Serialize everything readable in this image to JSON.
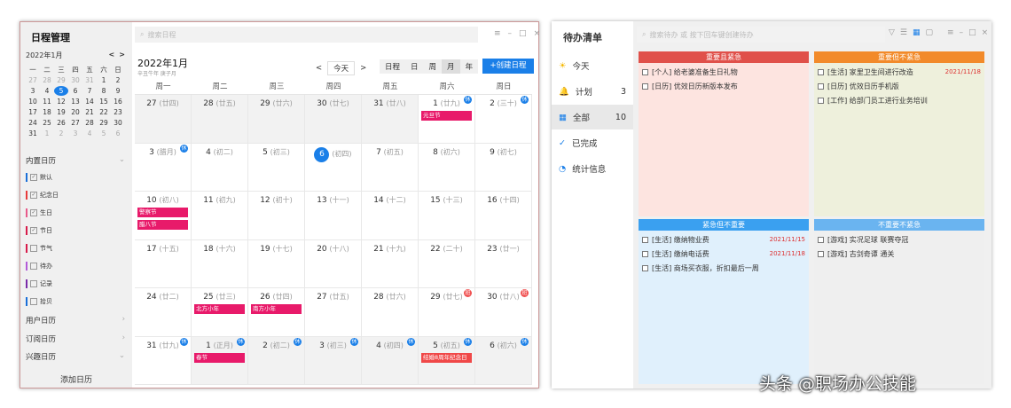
{
  "calendar": {
    "title": "日程管理",
    "mini": {
      "month": "2022年1月",
      "prev": "<",
      "next": ">",
      "weekdays": [
        "一",
        "二",
        "三",
        "四",
        "五",
        "六",
        "日"
      ],
      "days": [
        "27",
        "28",
        "29",
        "30",
        "31",
        "1",
        "2",
        "3",
        "4",
        "5",
        "6",
        "7",
        "8",
        "9",
        "10",
        "11",
        "12",
        "13",
        "14",
        "15",
        "16",
        "17",
        "18",
        "19",
        "20",
        "21",
        "22",
        "23",
        "24",
        "25",
        "26",
        "27",
        "28",
        "29",
        "30",
        "31",
        "1",
        "2",
        "3",
        "4",
        "5",
        "6"
      ]
    },
    "builtin_label": "内置日历",
    "calendars": [
      {
        "name": "默认",
        "color": "#1a6fd8",
        "checked": true
      },
      {
        "name": "纪念日",
        "color": "#e83a3a",
        "checked": true
      },
      {
        "name": "生日",
        "color": "#e85a8a",
        "checked": true
      },
      {
        "name": "节日",
        "color": "#d81b4a",
        "checked": true
      },
      {
        "name": "节气",
        "color": "#d81b4a",
        "checked": false
      },
      {
        "name": "待办",
        "color": "#b35ad8",
        "checked": false
      },
      {
        "name": "记录",
        "color": "#7a2aa8",
        "checked": false
      },
      {
        "name": "拾贝",
        "color": "#1a6fd8",
        "checked": false
      }
    ],
    "user_cal": "用户日历",
    "sub_cal": "订阅日历",
    "interest_cal": "兴趣日历",
    "add_cal": "添加日历",
    "search_placeholder": "搜索日程",
    "month_title": "2022年1月",
    "ganzhi": "辛丑牛年 庚子月",
    "prev": "<",
    "today": "今天",
    "next": ">",
    "views": [
      "日程",
      "日",
      "周",
      "月",
      "年"
    ],
    "active_view": "月",
    "create": "+创建日程",
    "week_headers": [
      "周一",
      "周二",
      "周三",
      "周四",
      "周五",
      "周六",
      "周日"
    ],
    "cells": [
      {
        "d": "27",
        "l": "(廿四)",
        "g": 1
      },
      {
        "d": "28",
        "l": "(廿五)",
        "g": 1
      },
      {
        "d": "29",
        "l": "(廿六)",
        "g": 1
      },
      {
        "d": "30",
        "l": "(廿七)",
        "g": 1
      },
      {
        "d": "31",
        "l": "(廿八)",
        "g": 1
      },
      {
        "d": "1",
        "l": "(廿九)",
        "b": "休",
        "ev": [
          "元旦节"
        ]
      },
      {
        "d": "2",
        "l": "(三十)",
        "b": "休"
      },
      {
        "d": "3",
        "l": "(腊月)",
        "b": "休"
      },
      {
        "d": "4",
        "l": "(初二)"
      },
      {
        "d": "5",
        "l": "(初三)"
      },
      {
        "d": "6",
        "l": "(初四)",
        "today": 1
      },
      {
        "d": "7",
        "l": "(初五)"
      },
      {
        "d": "8",
        "l": "(初六)"
      },
      {
        "d": "9",
        "l": "(初七)"
      },
      {
        "d": "10",
        "l": "(初八)",
        "ev": [
          "警察节",
          "腊八节"
        ]
      },
      {
        "d": "11",
        "l": "(初九)"
      },
      {
        "d": "12",
        "l": "(初十)"
      },
      {
        "d": "13",
        "l": "(十一)"
      },
      {
        "d": "14",
        "l": "(十二)"
      },
      {
        "d": "15",
        "l": "(十三)"
      },
      {
        "d": "16",
        "l": "(十四)"
      },
      {
        "d": "17",
        "l": "(十五)"
      },
      {
        "d": "18",
        "l": "(十六)"
      },
      {
        "d": "19",
        "l": "(十七)"
      },
      {
        "d": "20",
        "l": "(十八)"
      },
      {
        "d": "21",
        "l": "(十九)"
      },
      {
        "d": "22",
        "l": "(二十)"
      },
      {
        "d": "23",
        "l": "(廿一)"
      },
      {
        "d": "24",
        "l": "(廿二)"
      },
      {
        "d": "25",
        "l": "(廿三)",
        "ev": [
          "北方小年"
        ]
      },
      {
        "d": "26",
        "l": "(廿四)",
        "ev": [
          "南方小年"
        ]
      },
      {
        "d": "27",
        "l": "(廿五)"
      },
      {
        "d": "28",
        "l": "(廿六)"
      },
      {
        "d": "29",
        "l": "(廿七)",
        "b": "班"
      },
      {
        "d": "30",
        "l": "(廿八)",
        "b": "班"
      },
      {
        "d": "31",
        "l": "(廿九)",
        "b": "休"
      },
      {
        "d": "1",
        "l": "(正月)",
        "b": "休",
        "g": 1,
        "ev": [
          "春节"
        ]
      },
      {
        "d": "2",
        "l": "(初二)",
        "b": "休",
        "g": 1
      },
      {
        "d": "3",
        "l": "(初三)",
        "b": "休",
        "g": 1
      },
      {
        "d": "4",
        "l": "(初四)",
        "b": "休",
        "g": 1
      },
      {
        "d": "5",
        "l": "(初五)",
        "b": "休",
        "g": 1,
        "ev": [
          "结婚8周年纪念日"
        ],
        "evc": "#f04848"
      },
      {
        "d": "6",
        "l": "(初六)",
        "b": "休",
        "g": 1
      }
    ]
  },
  "todo": {
    "title": "待办清单",
    "nav": [
      {
        "label": "今天",
        "icon": "sun-icon",
        "sym": "☀",
        "c": "#f5b800"
      },
      {
        "label": "计划",
        "count": "3",
        "icon": "bell-icon",
        "sym": "🔔",
        "c": "#e89a30"
      },
      {
        "label": "全部",
        "count": "10",
        "icon": "grid-icon",
        "sym": "▦",
        "c": "#1a7fe8"
      },
      {
        "label": "已完成",
        "icon": "check-circle-icon",
        "sym": "✓",
        "c": "#1a7fe8"
      },
      {
        "label": "统计信息",
        "icon": "pie-chart-icon",
        "sym": "◔",
        "c": "#1a7fe8"
      }
    ],
    "search_placeholder": "搜索待办 或 按下回车键创建待办",
    "quadrants": [
      {
        "title": "重要且紧急",
        "head": "#e0504a",
        "bg": "#fde4e0",
        "items": [
          {
            "t": "[个人] 给老婆准备生日礼物"
          },
          {
            "t": "[日历] 优效日历新版本发布"
          }
        ]
      },
      {
        "title": "重要但不紧急",
        "head": "#f28a2a",
        "bg": "#eef0dc",
        "items": [
          {
            "t": "[生活] 家里卫生间进行改造",
            "d": "2021/11/18"
          },
          {
            "t": "[日历] 优效日历手机版"
          },
          {
            "t": "[工作] 给部门员工进行业务培训"
          }
        ]
      },
      {
        "title": "紧急但不重要",
        "head": "#3aa0f0",
        "bg": "#e0f0fc",
        "items": [
          {
            "t": "[生活] 缴纳物业费",
            "d": "2021/11/15"
          },
          {
            "t": "[生活] 缴纳电话费",
            "d": "2021/11/18"
          },
          {
            "t": "[生活] 商场买衣服，折扣最后一周"
          }
        ]
      },
      {
        "title": "不重要不紧急",
        "head": "#6ab4f0",
        "bg": "#efefef",
        "items": [
          {
            "t": "[游戏] 实况足球 联赛夺冠"
          },
          {
            "t": "[游戏] 古剑奇谭 通关"
          }
        ]
      }
    ]
  },
  "watermark": "头条 @职场办公技能"
}
